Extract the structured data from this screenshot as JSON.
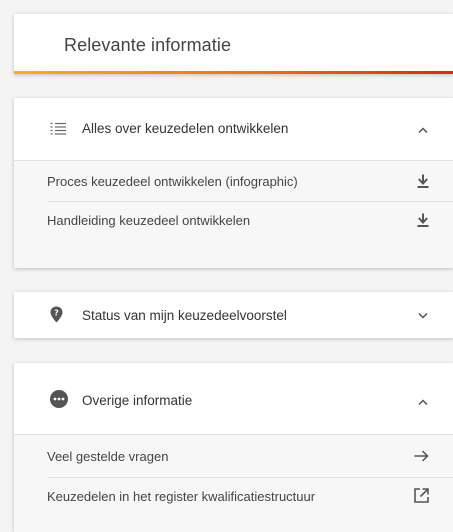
{
  "header": {
    "title": "Relevante informatie",
    "accent_gradient": [
      "#f2b21a",
      "#e9731b",
      "#d32a20"
    ]
  },
  "sections": [
    {
      "label": "Alles over keuzedelen ontwikkelen",
      "icon": "list-icon",
      "state": "expanded",
      "items": [
        {
          "label": "Proces keuzedeel ontwikkelen (infographic)",
          "icon": "download-icon"
        },
        {
          "label": "Handleiding keuzedeel ontwikkelen",
          "icon": "download-icon"
        }
      ]
    },
    {
      "label": "Status van mijn keuzedeelvoorstel",
      "icon": "map-pin-question-icon",
      "state": "collapsed",
      "items": []
    },
    {
      "label": "Overige informatie",
      "icon": "more-circle-icon",
      "state": "expanded",
      "items": [
        {
          "label": "Veel gestelde vragen",
          "icon": "arrow-right-icon"
        },
        {
          "label": "Keuzedelen in het register kwalificatiestructuur",
          "icon": "external-link-icon"
        }
      ]
    }
  ]
}
